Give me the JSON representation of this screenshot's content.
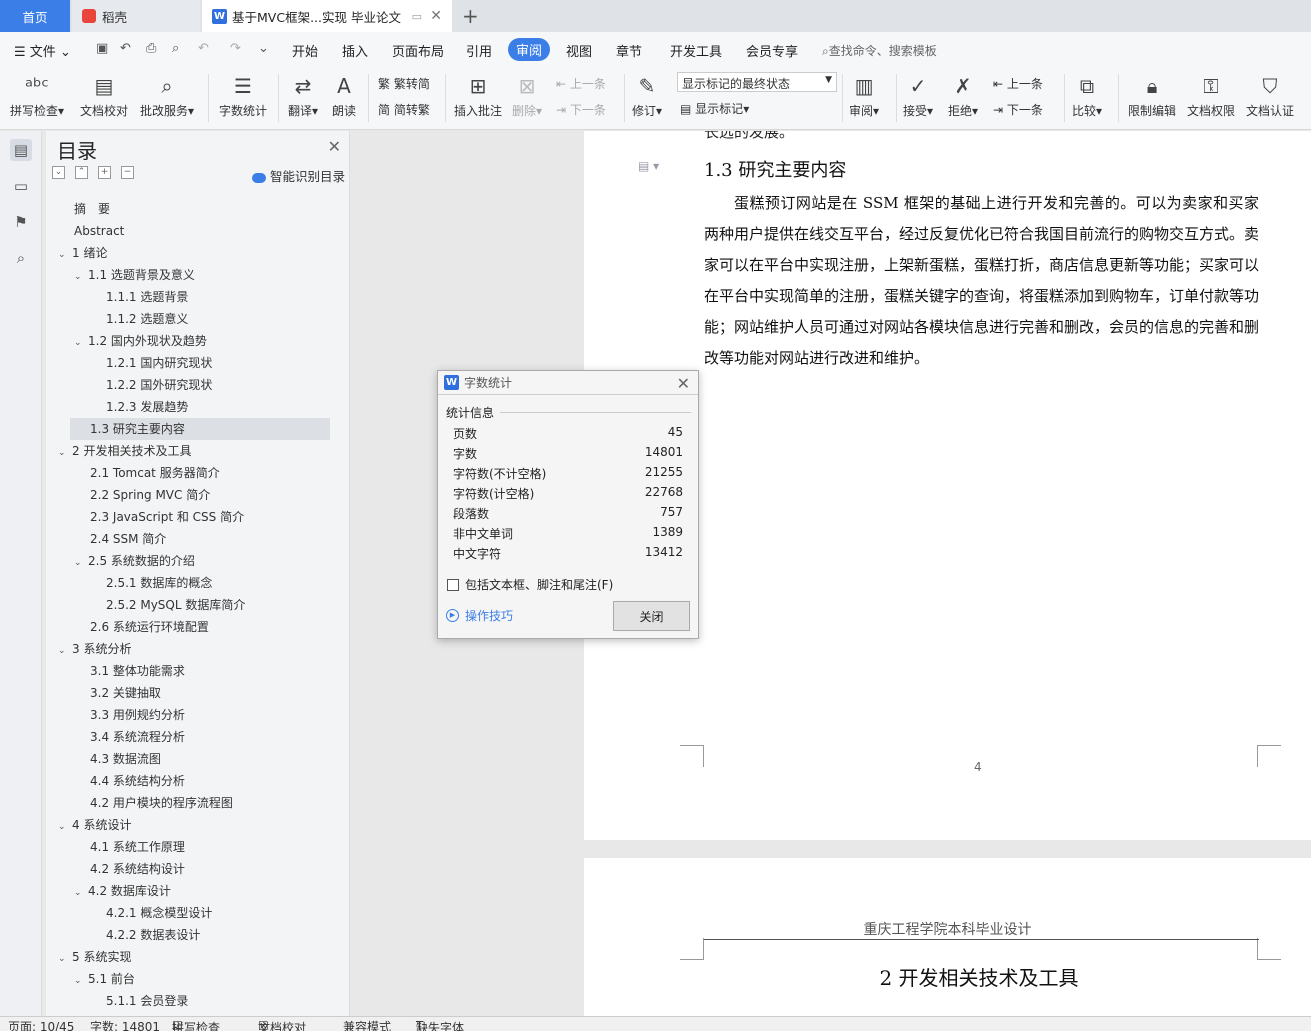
{
  "tabs": {
    "home": "首页",
    "daoke": "稻壳",
    "doc": "基于MVC框架...实现 毕业论文"
  },
  "menu": {
    "file": "文件",
    "items": [
      "开始",
      "插入",
      "页面布局",
      "引用",
      "审阅",
      "视图",
      "章节",
      "开发工具",
      "会员专享"
    ],
    "search": "查找命令、搜索模板"
  },
  "ribbon": {
    "spell": "拼写检查",
    "doc_check": "文档校对",
    "batch": "批改服务",
    "word_count": "字数统计",
    "translate": "翻译",
    "read": "朗读",
    "to_trad": "繁转简",
    "to_simp": "简转繁",
    "insert_comment": "插入批注",
    "delete": "删除",
    "prev": "上一条",
    "next": "下一条",
    "revise": "修订",
    "mark_state": "显示标记的最终状态",
    "show_mark": "显示标记",
    "review": "审阅",
    "accept": "接受",
    "reject": "拒绝",
    "prev2": "上一条",
    "next2": "下一条",
    "compare": "比较",
    "restrict": "限制编辑",
    "perm": "文档权限",
    "cert": "文档认证"
  },
  "toc": {
    "title": "目录",
    "ai": "智能识别目录",
    "items": [
      {
        "t": "摘　要",
        "lvl": 0,
        "arrow": ""
      },
      {
        "t": "Abstract",
        "lvl": 0,
        "arrow": ""
      },
      {
        "t": "1  绪论",
        "lvl": 0,
        "arrow": "v"
      },
      {
        "t": "1.1  选题背景及意义",
        "lvl": 1,
        "arrow": "v"
      },
      {
        "t": "1.1.1 选题背景",
        "lvl": 2,
        "arrow": ""
      },
      {
        "t": "1.1.2 选题意义",
        "lvl": 2,
        "arrow": ""
      },
      {
        "t": "1.2  国内外现状及趋势",
        "lvl": 1,
        "arrow": "v"
      },
      {
        "t": "1.2.1  国内研究现状",
        "lvl": 2,
        "arrow": ""
      },
      {
        "t": "1.2.2  国外研究现状",
        "lvl": 2,
        "arrow": ""
      },
      {
        "t": "1.2.3  发展趋势",
        "lvl": 2,
        "arrow": ""
      },
      {
        "t": "1.3  研究主要内容",
        "lvl": 1,
        "arrow": "",
        "sel": true
      },
      {
        "t": "2  开发相关技术及工具",
        "lvl": 0,
        "arrow": "v"
      },
      {
        "t": "2.1 Tomcat 服务器简介",
        "lvl": 1,
        "arrow": ""
      },
      {
        "t": "2.2 Spring MVC 简介",
        "lvl": 1,
        "arrow": ""
      },
      {
        "t": "2.3 JavaScript 和 CSS 简介",
        "lvl": 1,
        "arrow": ""
      },
      {
        "t": "2.4 SSM 简介",
        "lvl": 1,
        "arrow": ""
      },
      {
        "t": "2.5  系统数据的介绍",
        "lvl": 1,
        "arrow": "v"
      },
      {
        "t": "2.5.1  数据库的概念",
        "lvl": 2,
        "arrow": ""
      },
      {
        "t": "2.5.2 MySQL 数据库简介",
        "lvl": 2,
        "arrow": ""
      },
      {
        "t": "2.6  系统运行环境配置",
        "lvl": 1,
        "arrow": ""
      },
      {
        "t": "3  系统分析",
        "lvl": 0,
        "arrow": "v"
      },
      {
        "t": "3.1  整体功能需求",
        "lvl": 1,
        "arrow": ""
      },
      {
        "t": "3.2  关键抽取",
        "lvl": 1,
        "arrow": ""
      },
      {
        "t": "3.3  用例规约分析",
        "lvl": 1,
        "arrow": ""
      },
      {
        "t": "3.4  系统流程分析",
        "lvl": 1,
        "arrow": ""
      },
      {
        "t": "4.3  数据流图",
        "lvl": 1,
        "arrow": ""
      },
      {
        "t": "4.4  系统结构分析",
        "lvl": 1,
        "arrow": ""
      },
      {
        "t": "4.2  用户模块的程序流程图",
        "lvl": 1,
        "arrow": ""
      },
      {
        "t": "4  系统设计",
        "lvl": 0,
        "arrow": "v"
      },
      {
        "t": "4.1  系统工作原理",
        "lvl": 1,
        "arrow": ""
      },
      {
        "t": "4.2  系统结构设计",
        "lvl": 1,
        "arrow": ""
      },
      {
        "t": "4.2 数据库设计",
        "lvl": 1,
        "arrow": "v"
      },
      {
        "t": "4.2.1  概念模型设计",
        "lvl": 2,
        "arrow": ""
      },
      {
        "t": "4.2.2  数据表设计",
        "lvl": 2,
        "arrow": ""
      },
      {
        "t": "5  系统实现",
        "lvl": 0,
        "arrow": "v"
      },
      {
        "t": "5.1  前台",
        "lvl": 1,
        "arrow": "v"
      },
      {
        "t": "5.1.1  会员登录",
        "lvl": 2,
        "arrow": ""
      }
    ]
  },
  "doc": {
    "prev_tail": "长远的发展。",
    "heading": "1.3  研究主要内容",
    "para": "蛋糕预订网站是在 SSM 框架的基础上进行开发和完善的。可以为卖家和买家两种用户提供在线交互平台，经过反复优化已符合我国目前流行的购物交互方式。卖家可以在平台中实现注册，上架新蛋糕，蛋糕打折，商店信息更新等功能；买家可以在平台中实现简单的注册，蛋糕关键字的查询，将蛋糕添加到购物车，订单付款等功能；网站维护人员可通过对网站各模块信息进行完善和删改，会员的信息的完善和删改等功能对网站进行改进和维护。",
    "page_num": "4",
    "p2_header": "重庆工程学院本科毕业设计",
    "p2_title": "2  开发相关技术及工具"
  },
  "dialog": {
    "title": "字数统计",
    "section": "统计信息",
    "stats": [
      {
        "k": "页数",
        "v": "45"
      },
      {
        "k": "字数",
        "v": "14801"
      },
      {
        "k": "字符数(不计空格)",
        "v": "21255"
      },
      {
        "k": "字符数(计空格)",
        "v": "22768"
      },
      {
        "k": "段落数",
        "v": "757"
      },
      {
        "k": "非中文单词",
        "v": "1389"
      },
      {
        "k": "中文字符",
        "v": "13412"
      }
    ],
    "checkbox": "包括文本框、脚注和尾注(F)",
    "tips": "操作技巧",
    "close": "关闭"
  },
  "status": {
    "page": "页面: 10/45",
    "words": "字数: 14801",
    "spell": "拼写检查",
    "check": "文档校对",
    "compat": "兼容模式",
    "font": "缺失字体"
  }
}
